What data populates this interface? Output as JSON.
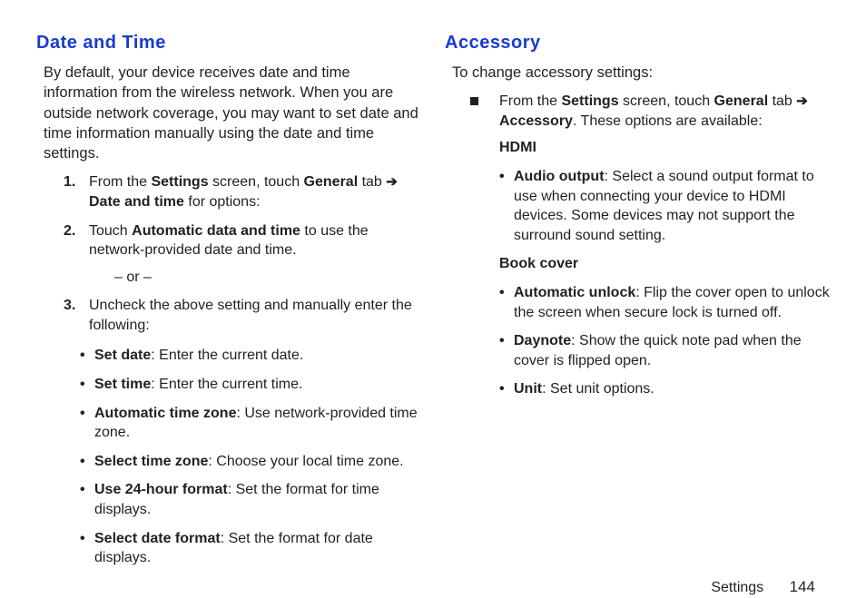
{
  "left": {
    "heading": "Date and Time",
    "intro": "By default, your device receives date and time information from the wireless network. When you are outside network coverage, you may want to set date and time information manually using the date and time settings.",
    "steps": [
      {
        "num": "1.",
        "pre": "From the ",
        "b1": "Settings",
        "mid1": " screen, touch ",
        "b2": "General",
        "mid2": " tab ",
        "arrow": "➔",
        "b3": "Date and time",
        "post": " for options:"
      },
      {
        "num": "2.",
        "pre": "Touch ",
        "b1": "Automatic data and time",
        "post": " to use the network-provided date and time."
      }
    ],
    "or": "– or –",
    "step3": {
      "num": "3.",
      "text": "Uncheck the above setting and manually enter the following:"
    },
    "bullets": [
      {
        "b": "Set date",
        "t": ": Enter the current date."
      },
      {
        "b": "Set time",
        "t": ": Enter the current time."
      },
      {
        "b": "Automatic time zone",
        "t": ": Use network-provided time zone."
      },
      {
        "b": "Select time zone",
        "t": ": Choose your local time zone."
      },
      {
        "b": "Use 24-hour format",
        "t": ": Set the format for time displays."
      },
      {
        "b": "Select date format",
        "t": ": Set the format for date displays."
      }
    ]
  },
  "right": {
    "heading": "Accessory",
    "intro": "To change accessory settings:",
    "square": {
      "pre": "From the ",
      "b1": "Settings",
      "mid1": " screen, touch ",
      "b2": "General",
      "mid2": " tab ",
      "arrow": "➔",
      "b3": "Accessory",
      "post": ". These options are available:"
    },
    "hdmi_head": "HDMI",
    "hdmi_bullets": [
      {
        "b": "Audio output",
        "t": ": Select a sound output format to use when connecting your device to HDMI devices. Some devices may not support the surround sound setting."
      }
    ],
    "book_head": "Book cover",
    "book_bullets": [
      {
        "b": "Automatic unlock",
        "t": ": Flip the cover open to unlock the screen when secure lock is turned off."
      },
      {
        "b": "Daynote",
        "t": ": Show the quick note pad when the cover is flipped open."
      },
      {
        "b": "Unit",
        "t": ": Set unit options."
      }
    ]
  },
  "footer": {
    "section": "Settings",
    "page": "144"
  }
}
